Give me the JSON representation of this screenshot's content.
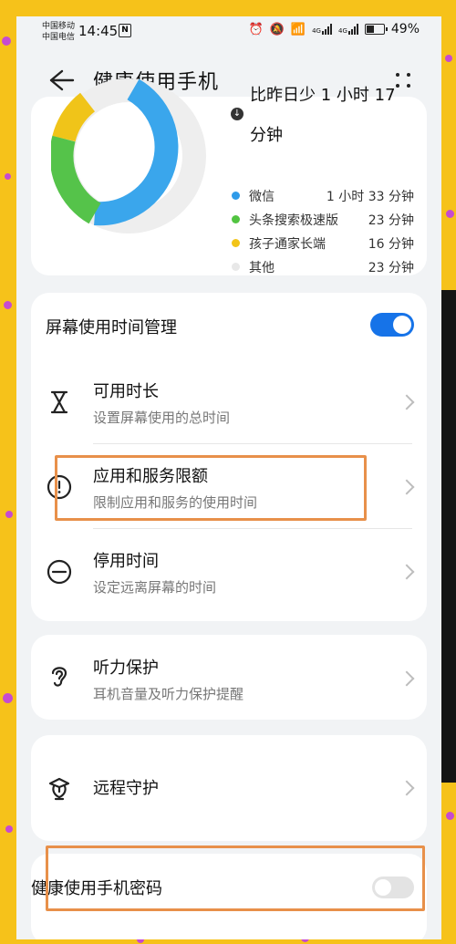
{
  "status_bar": {
    "carrier_1": "中国移动",
    "carrier_2": "中国电信",
    "time": "14:45",
    "nfc": "N",
    "net_1": "4G",
    "net_2": "4G",
    "battery": "49%"
  },
  "header": {
    "title": "健康使用手机"
  },
  "usage": {
    "compare_line1": "比昨日少 1 小时 17",
    "compare_line2": "分钟",
    "apps": [
      {
        "name": "微信",
        "time": "1 小时 33 分钟",
        "color": "#2f9be9"
      },
      {
        "name": "头条搜索极速版",
        "time": "23 分钟",
        "color": "#52c441"
      },
      {
        "name": "孩子通家长端",
        "time": "16 分钟",
        "color": "#f2c418"
      },
      {
        "name": "其他",
        "time": "23 分钟",
        "color": "#e8e8e8"
      }
    ]
  },
  "screen_time": {
    "title": "屏幕使用时间管理",
    "enabled": true,
    "items": [
      {
        "title": "可用时长",
        "subtitle": "设置屏幕使用的总时间"
      },
      {
        "title": "应用和服务限额",
        "subtitle": "限制应用和服务的使用时间"
      },
      {
        "title": "停用时间",
        "subtitle": "设定远离屏幕的时间"
      }
    ]
  },
  "hearing": {
    "title": "听力保护",
    "subtitle": "耳机音量及听力保护提醒"
  },
  "remote": {
    "title": "远程守护"
  },
  "password": {
    "title": "健康使用手机密码",
    "enabled": false
  },
  "colors": {
    "accent": "#1673e8",
    "highlight": "#e8904a",
    "background": "#f6c21a"
  }
}
